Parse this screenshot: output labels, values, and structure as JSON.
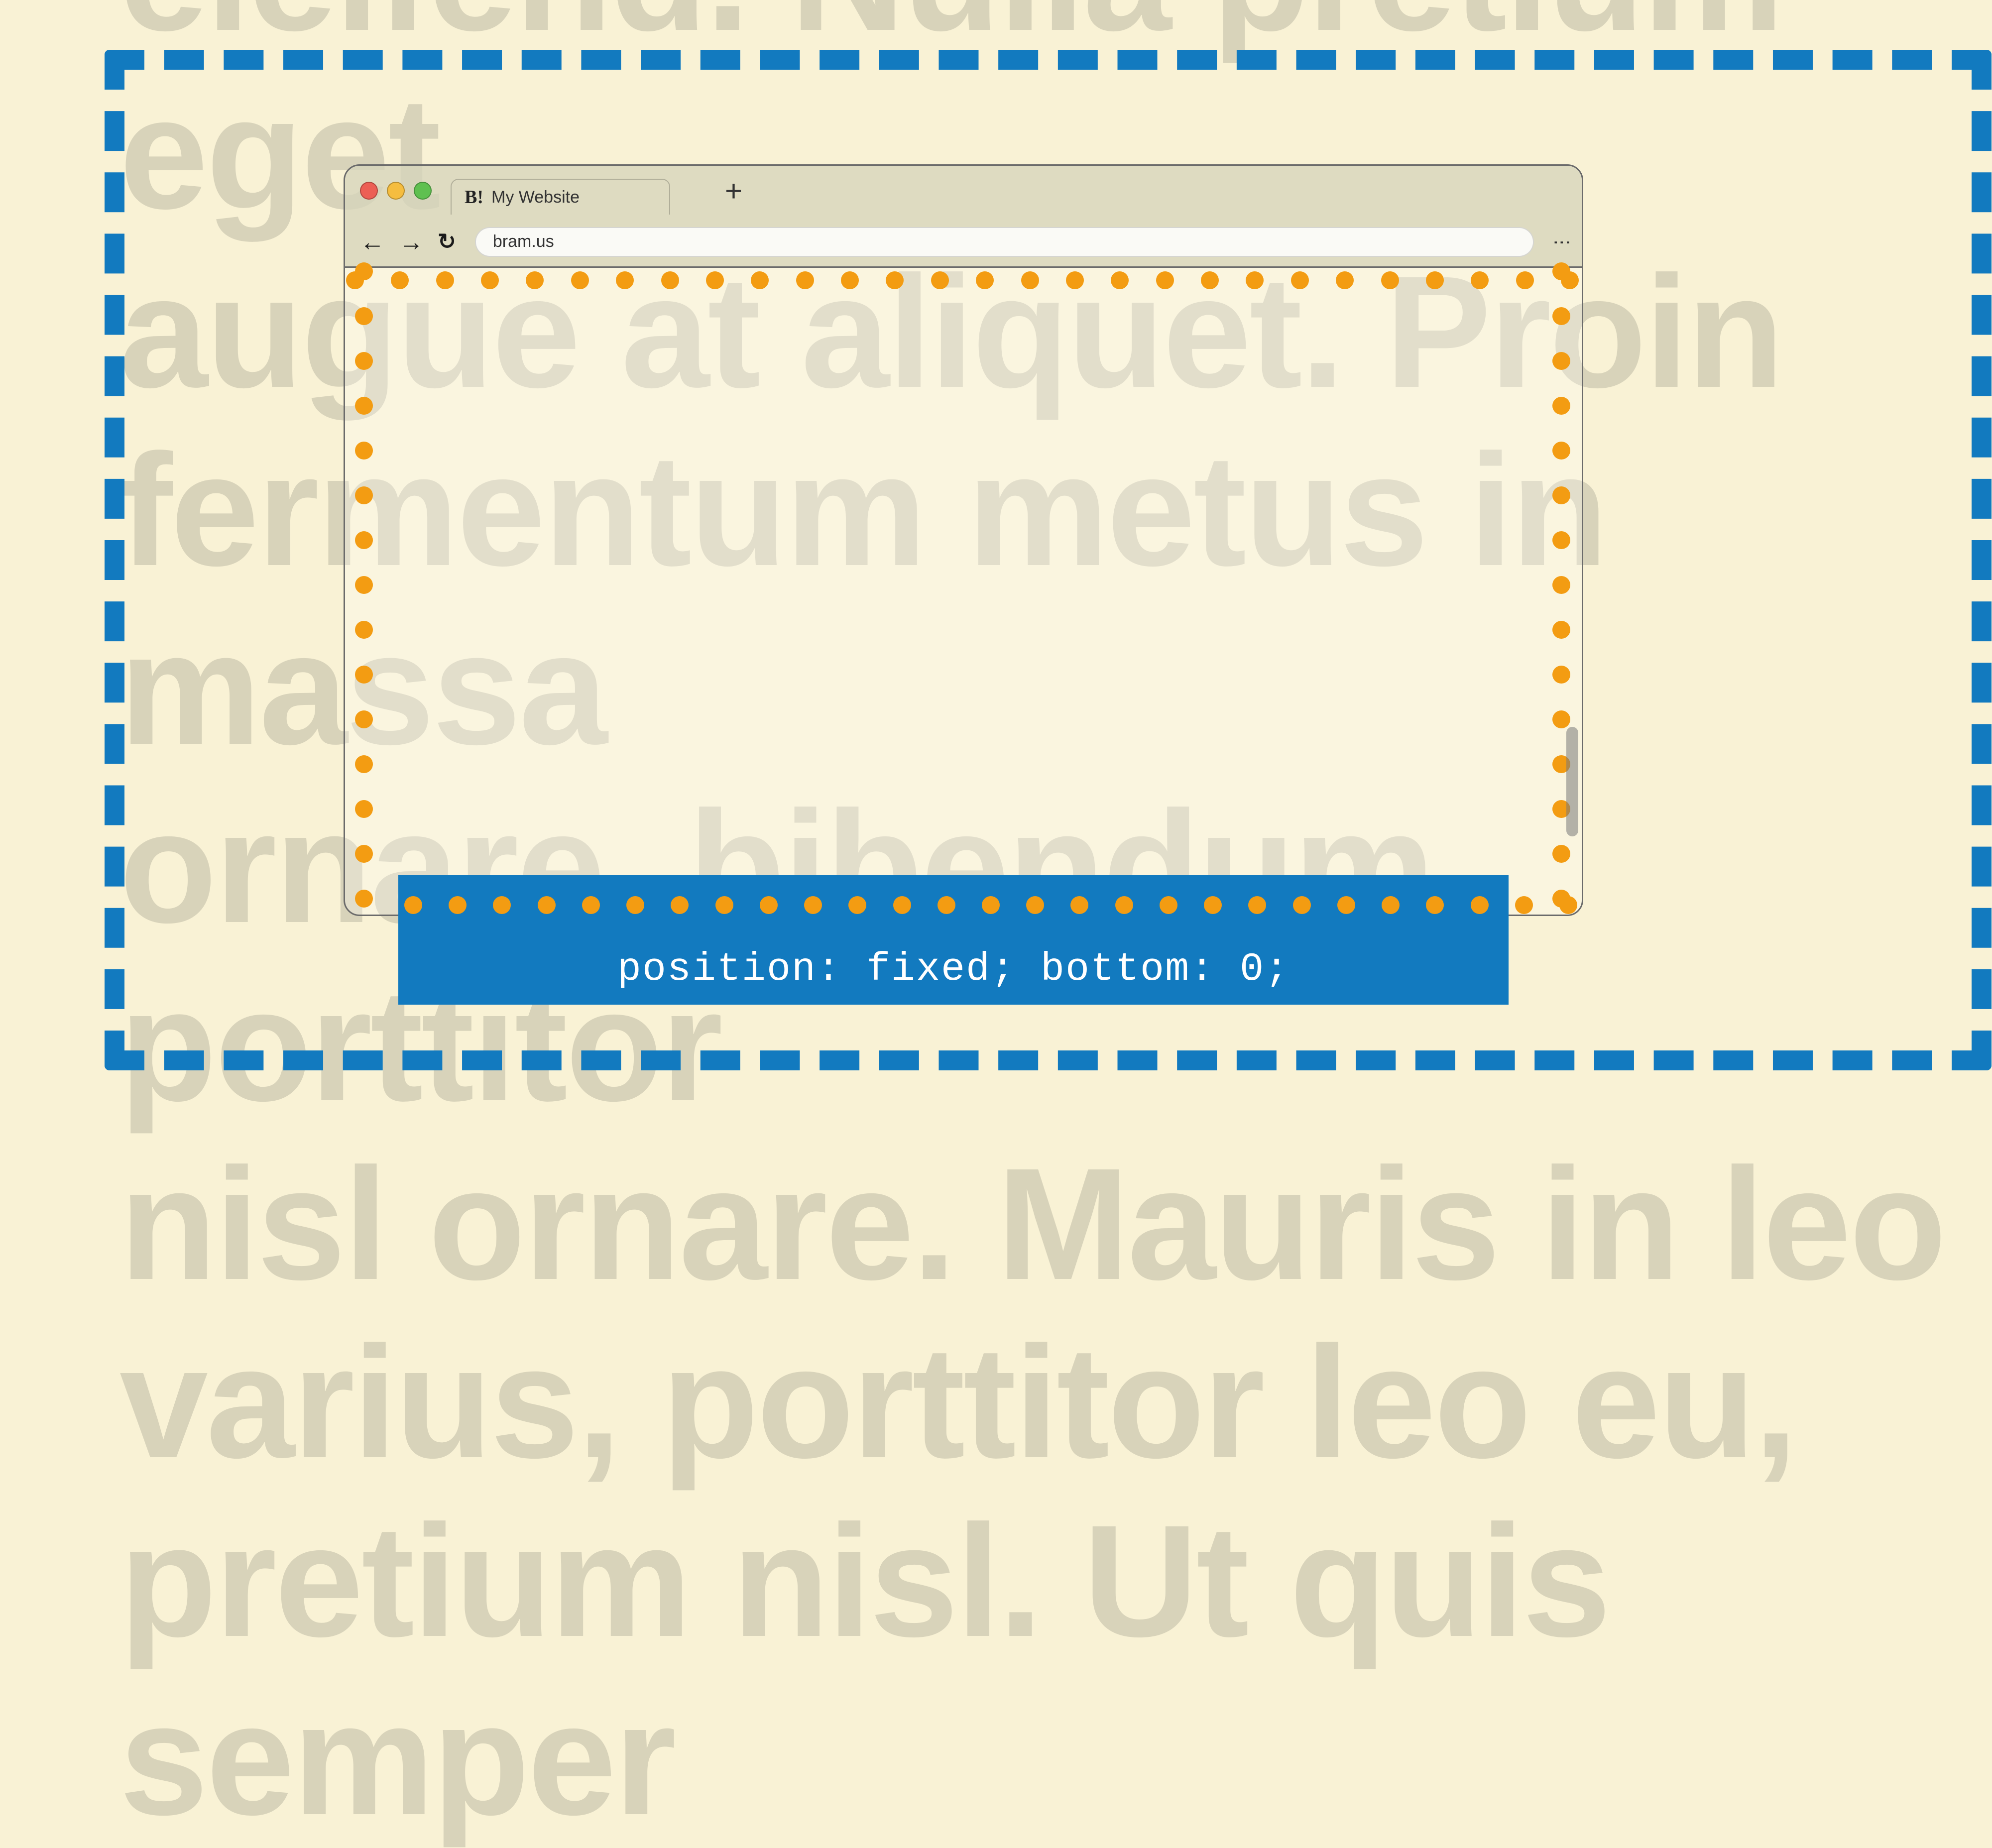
{
  "background": {
    "lorem": "eleifend. Nulla pretium eget\naugue at aliquet. Proin\nfermentum metus in massa\nornare, bibendum porttitor\nnisl ornare. Mauris in leo\nvarius, porttitor leo eu,\npretium nisl. Ut quis semper"
  },
  "browser": {
    "tab": {
      "title": "My Website",
      "favicon": "B!"
    },
    "plus": "+",
    "nav": {
      "back": "←",
      "forward": "→",
      "reload": "↻",
      "menu": "⋮"
    },
    "url": "bram.us"
  },
  "code": {
    "fixed_label": "position: fixed; bottom: 0;"
  },
  "colors": {
    "accent_blue": "#127abf",
    "dot_orange": "#f39c12",
    "bg_cream": "#f9f2d5"
  }
}
